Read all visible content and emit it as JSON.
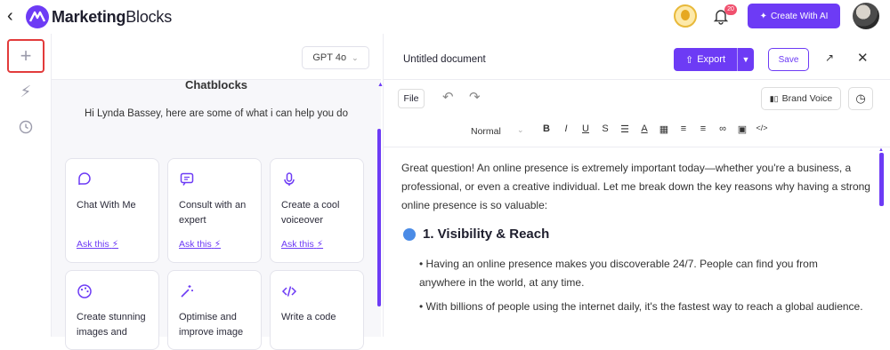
{
  "header": {
    "brand_bold": "Marketing",
    "brand_rest": "Blocks",
    "notification_count": "20",
    "create_ai_label": "Create With AI",
    "accent": "#6d3bf5"
  },
  "chat": {
    "model": "GPT 4o",
    "title": "Chatblocks",
    "greeting": "Hi Lynda Bassey, here are some of what i can help you do",
    "cards": [
      {
        "icon": "chat-bubble-icon",
        "label": "Chat With Me",
        "ask": "Ask this"
      },
      {
        "icon": "message-square-icon",
        "label": "Consult with an expert",
        "ask": "Ask this"
      },
      {
        "icon": "microphone-icon",
        "label": "Create a cool voiceover",
        "ask": "Ask this"
      },
      {
        "icon": "palette-icon",
        "label": "Create stunning images and",
        "ask": ""
      },
      {
        "icon": "magic-wand-icon",
        "label": "Optimise and improve image",
        "ask": ""
      },
      {
        "icon": "code-icon",
        "label": "Write a code",
        "ask": ""
      }
    ]
  },
  "editor": {
    "doc_title": "Untitled document",
    "export_label": "Export",
    "save_label": "Save",
    "file_label": "File",
    "brand_voice_label": "Brand Voice",
    "format": "Normal",
    "paragraph": "Great question! An online presence is extremely important today—whether you're a business, a professional, or even a creative individual. Let me break down the key reasons why having a strong online presence is so valuable:",
    "heading": "1. Visibility & Reach",
    "bullets": [
      "Having an online presence makes you discoverable 24/7. People can find you from anywhere in the world, at any time.",
      "With billions of people using the internet daily, it's the fastest way to reach a global audience."
    ]
  }
}
